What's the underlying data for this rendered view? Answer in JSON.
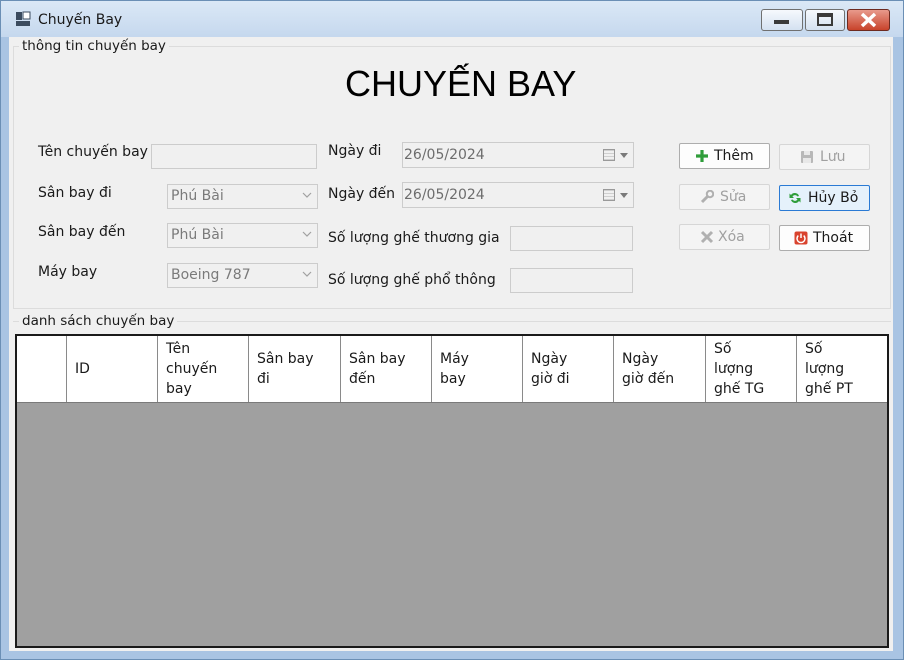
{
  "window": {
    "title": "Chuyến Bay"
  },
  "info_group": {
    "legend": "thông tin chuyến bay",
    "heading": "CHUYẾN BAY",
    "labels": {
      "ten_chuyen_bay": "Tên chuyến bay",
      "san_bay_di": "Sân bay đi",
      "san_bay_den": "Sân bay đến",
      "may_bay": "Máy bay",
      "ngay_di": "Ngày đi",
      "ngay_den": "Ngày đến",
      "ghe_thuong_gia": "Số lượng ghế thương gia",
      "ghe_pho_thong": "Số lượng ghế phổ thông"
    },
    "values": {
      "ten_chuyen_bay": "",
      "san_bay_di": "Phú Bài",
      "san_bay_den": "Phú Bài",
      "may_bay": "Boeing 787",
      "ngay_di": "26/05/2024",
      "ngay_den": "26/05/2024",
      "ghe_thuong_gia": "",
      "ghe_pho_thong": ""
    }
  },
  "buttons": {
    "them": "Thêm",
    "luu": "Lưu",
    "sua": "Sửa",
    "huy_bo": "Hủy Bỏ",
    "xoa": "Xóa",
    "thoat": "Thoát"
  },
  "list_group": {
    "legend": "danh sách chuyến bay",
    "columns": [
      "ID",
      "Tên\nchuyến\nbay",
      "Sân bay\nđi",
      "Sân bay\nđến",
      "Máy\nbay",
      "Ngày\ngiờ đi",
      "Ngày\ngiờ đến",
      "Số\nlượng\nghế TG",
      "Số\nlượng\nghế PT"
    ]
  },
  "colors": {
    "accent": "#2a7ad4",
    "grid_background": "#a0a0a0",
    "close_button": "#c8432b"
  }
}
